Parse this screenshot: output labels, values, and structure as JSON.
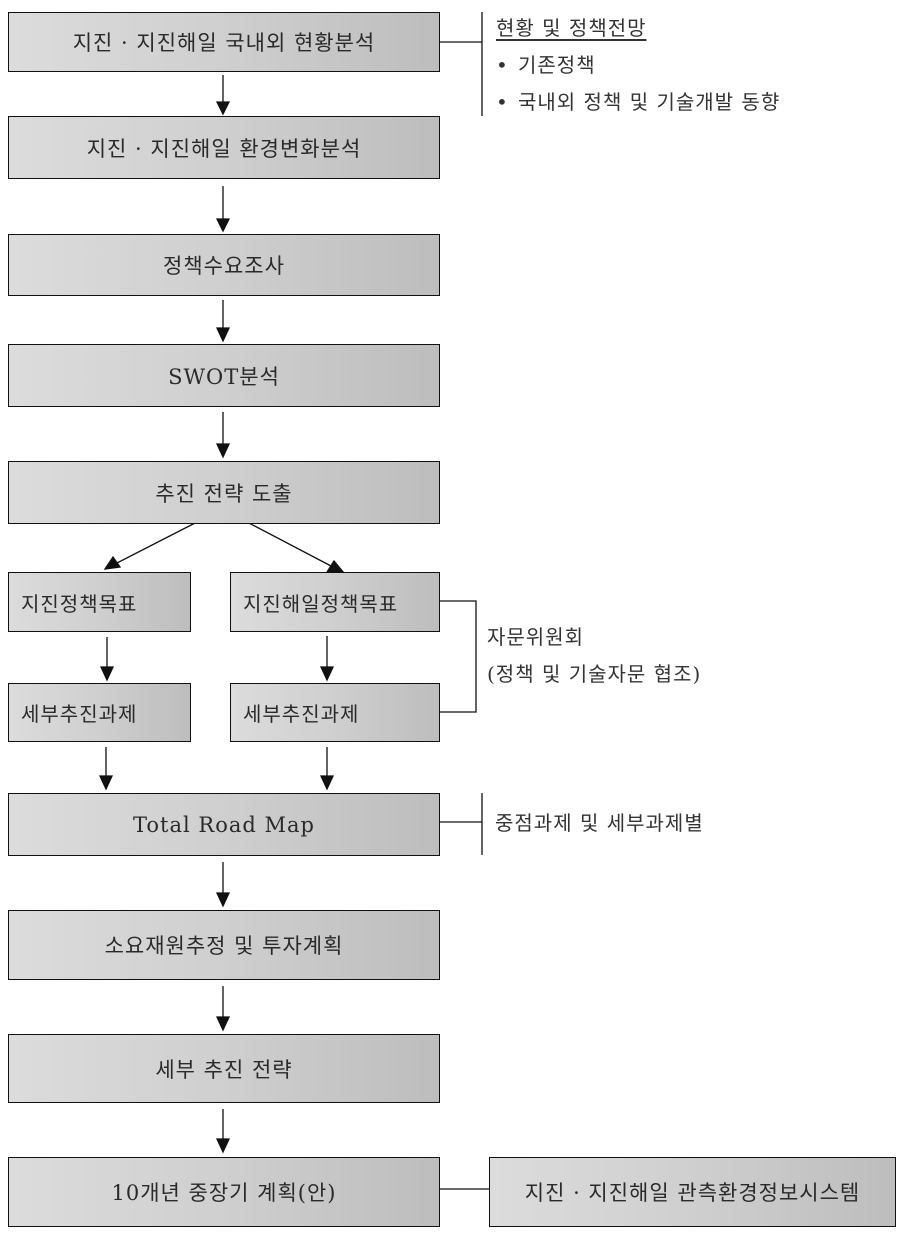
{
  "flow": {
    "steps": [
      {
        "id": "status-analysis",
        "label": "지진 · 지진해일 국내외 현황분석"
      },
      {
        "id": "environment-analysis",
        "label": "지진 · 지진해일 환경변화분석"
      },
      {
        "id": "policy-demand-survey",
        "label": "정책수요조사"
      },
      {
        "id": "swot-analysis",
        "label": "SWOT분석"
      },
      {
        "id": "strategy-derivation",
        "label": "추진 전략 도출"
      },
      {
        "id": "total-road-map",
        "label": "Total Road Map"
      },
      {
        "id": "funding-plan",
        "label": "소요재원추정 및 투자계획"
      },
      {
        "id": "detailed-strategy",
        "label": "세부 추진 전략"
      },
      {
        "id": "ten-year-plan",
        "label": "10개년 중장기 계획(안)"
      }
    ],
    "branches": {
      "left": {
        "goal": "지진정책목표",
        "tasks": "세부추진과제"
      },
      "right": {
        "goal": "지진해일정책목표",
        "tasks": "세부추진과제"
      }
    }
  },
  "annotations": {
    "status": {
      "heading": "현황 및 정책전망",
      "bullet_symbol": "•",
      "items": [
        "기존정책",
        "국내외 정책 및 기술개발 동향"
      ]
    },
    "advisory": {
      "line1": "자문위원회",
      "line2": "(정책 및 기술자문 협조)"
    },
    "roadmap": {
      "text": "중점과제 및 세부과제별"
    },
    "system": {
      "label": "지진 · 지진해일 관측환경정보시스템"
    }
  }
}
